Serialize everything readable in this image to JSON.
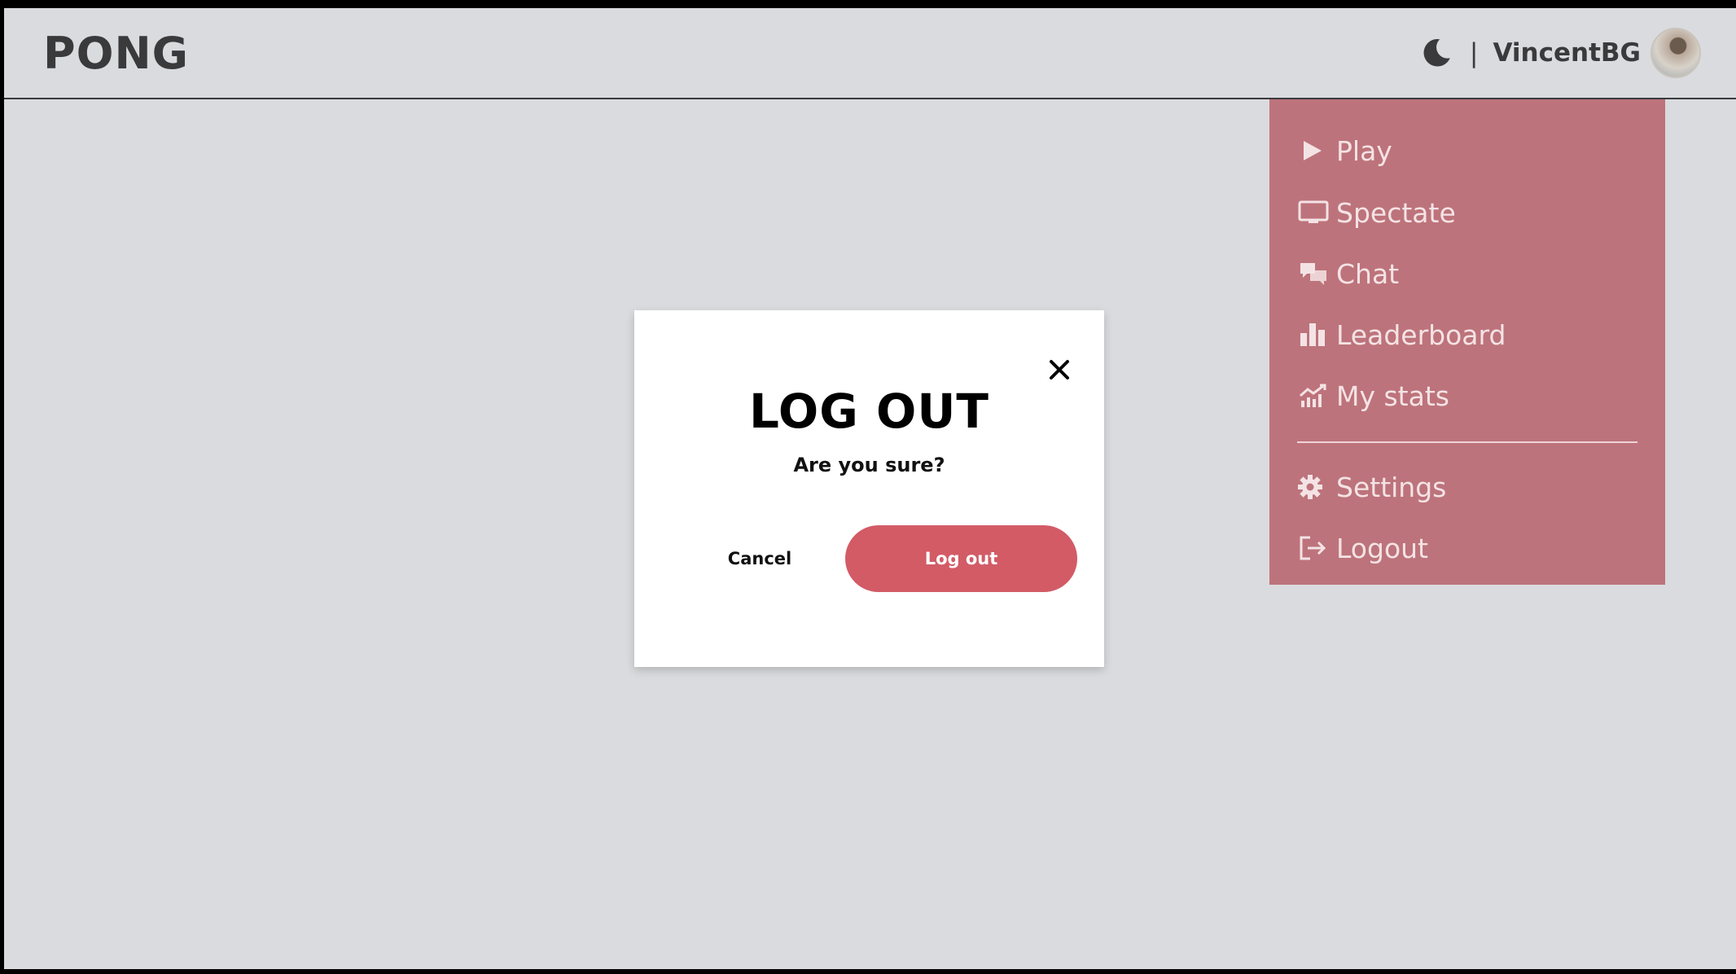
{
  "header": {
    "logo": "PONG",
    "separator": "|",
    "username": "VincentBG",
    "theme_icon": "moon-icon",
    "avatar_icon": "user-avatar"
  },
  "menu": {
    "items": [
      {
        "label": "Play",
        "icon": "play-icon"
      },
      {
        "label": "Spectate",
        "icon": "monitor-icon"
      },
      {
        "label": "Chat",
        "icon": "chat-icon"
      },
      {
        "label": "Leaderboard",
        "icon": "leaderboard-icon"
      },
      {
        "label": "My stats",
        "icon": "stats-icon"
      },
      {
        "label": "Settings",
        "icon": "gear-icon"
      },
      {
        "label": "Logout",
        "icon": "logout-icon"
      }
    ]
  },
  "modal": {
    "title": "LOG OUT",
    "subtitle": "Are you sure?",
    "cancel_label": "Cancel",
    "confirm_label": "Log out",
    "close_icon": "close-icon"
  },
  "colors": {
    "background": "#dadbde",
    "menu_background": "#bd737b",
    "accent": "#d25b66",
    "text_dark": "#3a3a3d"
  }
}
